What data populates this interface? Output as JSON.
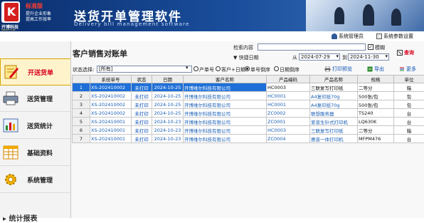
{
  "brand": {
    "edition": "标准版",
    "slogan_line1": "提升企业形象",
    "slogan_line2": "提高工作效率",
    "company": "开博科技",
    "domain": "KBSOFT.COM",
    "logo_letter": "K"
  },
  "app": {
    "title": "送货开单管理软件",
    "subtitle": "Delivery bill management software"
  },
  "topbar": {
    "admin_label": "系统管理员",
    "settings_label": "系统参数设置"
  },
  "sidebar": {
    "items": [
      {
        "label": "开送货单",
        "active": true
      },
      {
        "label": "送货管理",
        "active": false
      },
      {
        "label": "送货统计",
        "active": false
      },
      {
        "label": "基础资料",
        "active": false
      },
      {
        "label": "系统管理",
        "active": false
      }
    ],
    "section": "统计报表"
  },
  "main": {
    "page_title": "客户销售对账单",
    "search_label": "检索内容",
    "search_value": "",
    "fuzzy_label": "模糊",
    "fuzzy_checked": true,
    "query_label": "查询",
    "date_filter_label": "快捷日期",
    "from_label": "从",
    "date_from": "2024-07-29",
    "to_label": "到",
    "date_to": "2024-11-30",
    "status_label": "状态选择:",
    "status_value": "[所有]",
    "sort_options": [
      "产单号",
      "客户+日期",
      "单号倒序",
      "日期倒序"
    ],
    "sort_selected": 2,
    "print_label": "打印预览",
    "export_label": "导出",
    "more_label": "更多"
  },
  "table": {
    "columns": [
      "",
      "系统单号",
      "状态",
      "日期",
      "客户名称",
      "产品编码",
      "产品名称",
      "规格",
      "单位"
    ],
    "rows": [
      {
        "no": "1",
        "order": "XS-202410002",
        "status": "未打印",
        "date": "2024-10-25",
        "customer": "开博维尔科技有限公司",
        "code": "HC0003",
        "name": "三联复写打印纸",
        "spec": "二等分",
        "unit": "箱",
        "selected": true
      },
      {
        "no": "2",
        "order": "XS-202410002",
        "status": "未打印",
        "date": "2024-10-25",
        "customer": "开博维尔科技有限公司",
        "code": "HC0001",
        "name": "A4复印纸70g",
        "spec": "500张/包",
        "unit": "包",
        "selected": false
      },
      {
        "no": "3",
        "order": "XS-202410002",
        "status": "未打印",
        "date": "2024-10-25",
        "customer": "开博维尔科技有限公司",
        "code": "HC0001",
        "name": "A4复印纸70g",
        "spec": "500张/包",
        "unit": "包",
        "selected": false
      },
      {
        "no": "4",
        "order": "XS-202410002",
        "status": "未打印",
        "date": "2024-10-25",
        "customer": "开博维尔科技有限公司",
        "code": "ZC0002",
        "name": "联想服务器",
        "spec": "TS240",
        "unit": "台",
        "selected": false
      },
      {
        "no": "5",
        "order": "XS-202410001",
        "status": "未打印",
        "date": "2024-10-23",
        "customer": "开博维尔科技有限公司",
        "code": "ZC0001",
        "name": "爱普生针式打印机",
        "spec": "LQ630K",
        "unit": "台",
        "selected": false
      },
      {
        "no": "6",
        "order": "XS-202410001",
        "status": "未打印",
        "date": "2024-10-23",
        "customer": "开博维尔科技有限公司",
        "code": "HC0003",
        "name": "三联复写打印纸",
        "spec": "二等分",
        "unit": "箱",
        "selected": false
      },
      {
        "no": "7",
        "order": "XS-202410001",
        "status": "未打印",
        "date": "2024-10-23",
        "customer": "开博维尔科技有限公司",
        "code": "ZC0004",
        "name": "惠普一体打印机",
        "spec": "MFPM476",
        "unit": "台",
        "selected": false
      }
    ]
  },
  "colors": {
    "header_bg": "#0b2f6e",
    "accent_red": "#d9001b",
    "selection": "#1e6fd8",
    "link_blue": "#1a5fb4"
  },
  "icons": {
    "user": "user-icon",
    "settings": "settings-icon",
    "print": "printer-icon",
    "export": "export-icon",
    "more": "more-icon"
  }
}
